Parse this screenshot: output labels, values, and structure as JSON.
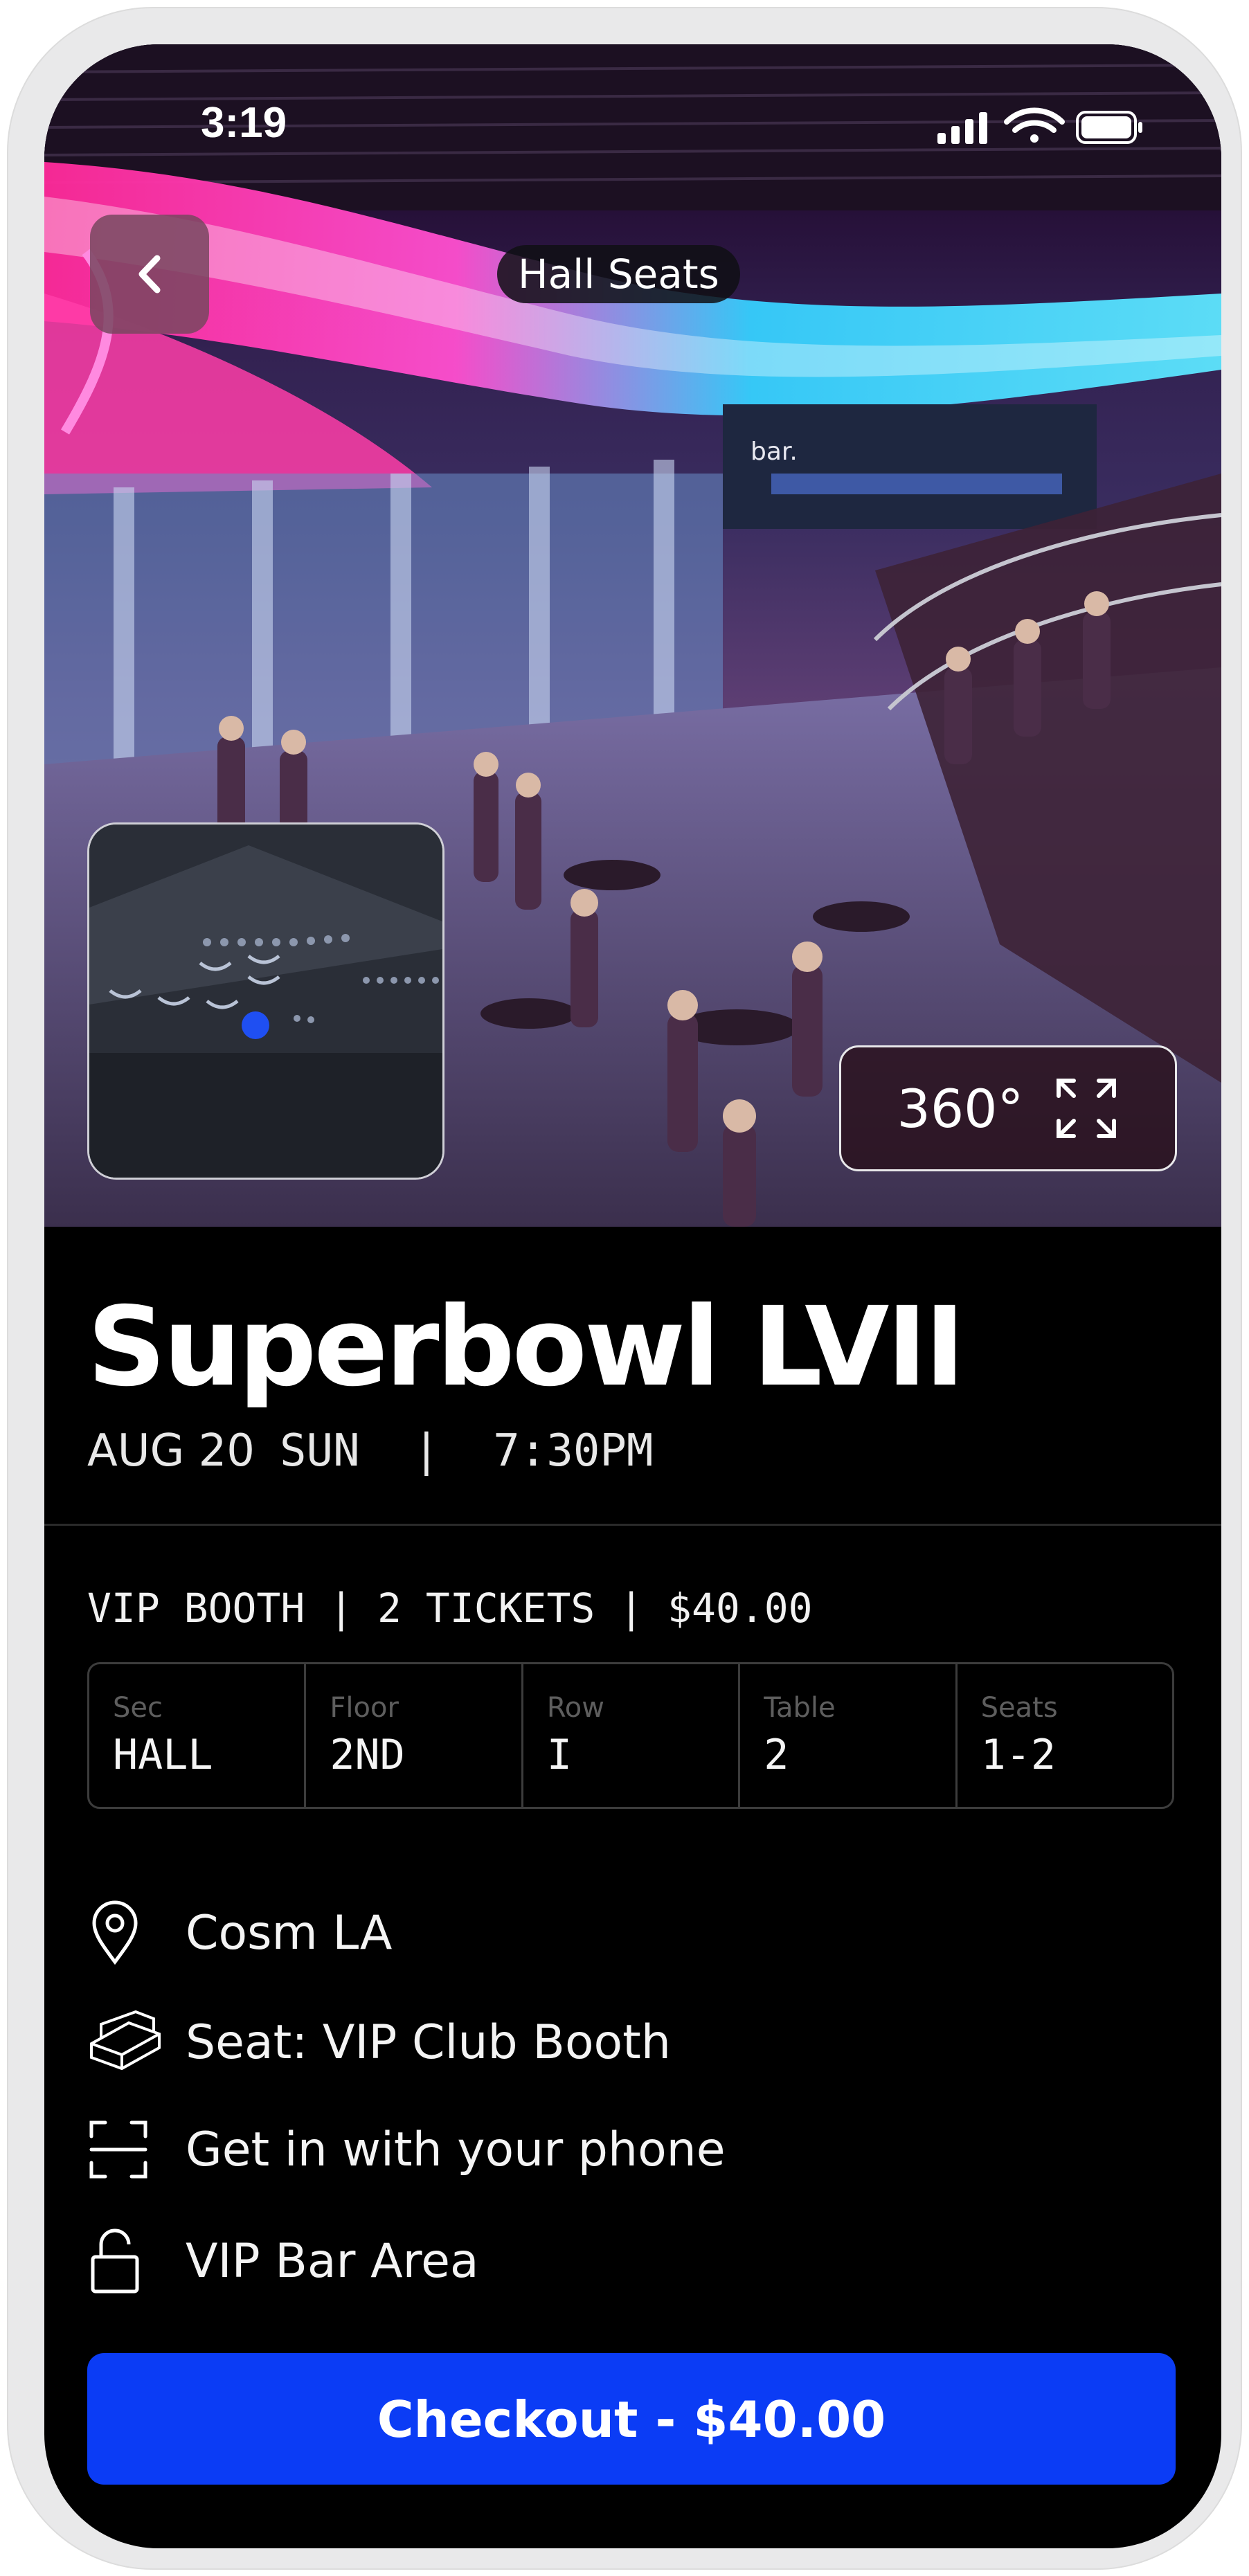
{
  "status_bar": {
    "time": "3:19"
  },
  "hero": {
    "venue_pill": "Hall Seats",
    "bar_sign": "bar.",
    "view_button_label": "360°"
  },
  "event": {
    "title": "Superbowl LVII",
    "date": "AUG 20",
    "day_time": "SUN  |  7:30PM"
  },
  "ticket": {
    "summary": "VIP BOOTH | 2 TICKETS | $40.00",
    "seat_details": [
      {
        "label": "Sec",
        "value": "HALL"
      },
      {
        "label": "Floor",
        "value": "2ND"
      },
      {
        "label": "Row",
        "value": "I"
      },
      {
        "label": "Table",
        "value": "2"
      },
      {
        "label": "Seats",
        "value": "1-2"
      }
    ]
  },
  "features": [
    {
      "icon": "location-pin-icon",
      "text": "Cosm LA"
    },
    {
      "icon": "booth-seat-icon",
      "text": "Seat: VIP Club Booth"
    },
    {
      "icon": "scan-icon",
      "text": "Get in with your phone"
    },
    {
      "icon": "unlock-icon",
      "text": "VIP Bar Area"
    }
  ],
  "checkout": {
    "label": "Checkout - $40.00"
  },
  "colors": {
    "accent": "#0b3cf5",
    "background": "#000000",
    "text": "#ffffff"
  }
}
